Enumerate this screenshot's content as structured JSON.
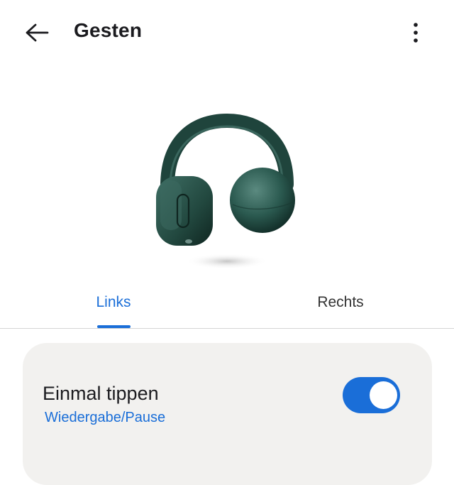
{
  "app_bar": {
    "title": "Gesten",
    "back_icon": "arrow-left-icon",
    "more_icon": "more-vertical-icon"
  },
  "hero": {
    "image": "open-ear-headphones-green"
  },
  "tabs": [
    {
      "label": "Links",
      "selected": true
    },
    {
      "label": "Rechts",
      "selected": false
    }
  ],
  "gestures": [
    {
      "title": "Einmal tippen",
      "action": "Wiedergabe/Pause",
      "enabled": true
    }
  ],
  "colors": {
    "accent": "#1a6ed8",
    "card_bg": "#f2f1ef",
    "headphone": "#2b5a50"
  }
}
